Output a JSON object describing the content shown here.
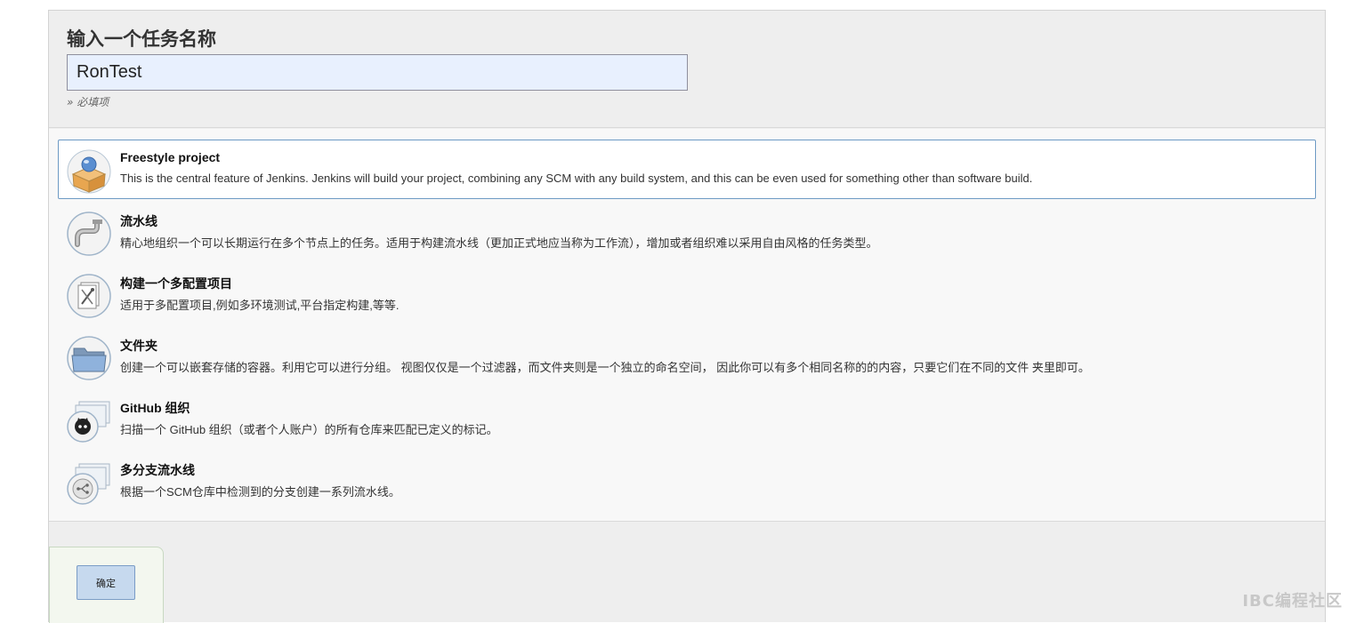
{
  "header": {
    "title": "输入一个任务名称",
    "name_value": "RonTest",
    "required_note": "» 必填项"
  },
  "items": [
    {
      "title": "Freestyle project",
      "desc": "This is the central feature of Jenkins. Jenkins will build your project, combining any SCM with any build system, and this can be even used for something other than software build.",
      "icon": "freestyle-project-icon",
      "selected": true
    },
    {
      "title": "流水线",
      "desc": "精心地组织一个可以长期运行在多个节点上的任务。适用于构建流水线（更加正式地应当称为工作流），增加或者组织难以采用自由风格的任务类型。",
      "icon": "pipeline-icon",
      "selected": false
    },
    {
      "title": "构建一个多配置项目",
      "desc": "适用于多配置项目,例如多环境测试,平台指定构建,等等.",
      "icon": "multi-config-icon",
      "selected": false
    },
    {
      "title": "文件夹",
      "desc": "创建一个可以嵌套存储的容器。利用它可以进行分组。 视图仅仅是一个过滤器，而文件夹则是一个独立的命名空间， 因此你可以有多个相同名称的的内容，只要它们在不同的文件 夹里即可。",
      "icon": "folder-icon",
      "selected": false
    },
    {
      "title": "GitHub 组织",
      "desc": "扫描一个 GitHub 组织（或者个人账户）的所有仓库来匹配已定义的标记。",
      "icon": "github-org-icon",
      "selected": false
    },
    {
      "title": "多分支流水线",
      "desc": "根据一个SCM仓库中检测到的分支创建一系列流水线。",
      "icon": "multibranch-pipeline-icon",
      "selected": false
    }
  ],
  "footer": {
    "ok_label": "确定"
  },
  "watermark": "IBC编程社区",
  "colors": {
    "selected_border": "#6d9ac4",
    "input_background": "#e8f0fe",
    "button_background": "#c6d9ee"
  }
}
